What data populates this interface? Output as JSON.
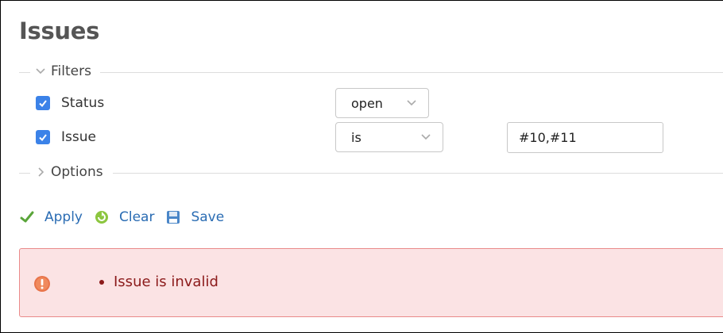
{
  "page": {
    "title": "Issues"
  },
  "filters": {
    "legend": "Filters",
    "rows": [
      {
        "label": "Status",
        "checked": true,
        "operator": "open"
      },
      {
        "label": "Issue",
        "checked": true,
        "operator": "is",
        "value": "#10,#11"
      }
    ]
  },
  "options": {
    "legend": "Options"
  },
  "actions": {
    "apply": "Apply",
    "clear": "Clear",
    "save": "Save"
  },
  "flash": {
    "type": "error",
    "messages": [
      "Issue is invalid"
    ]
  },
  "colors": {
    "link": "#2a6cb3",
    "checkbox": "#3b82e8",
    "error_bg": "#fbe3e4",
    "error_border": "#ea8a8a",
    "error_text": "#8b1a1a"
  }
}
